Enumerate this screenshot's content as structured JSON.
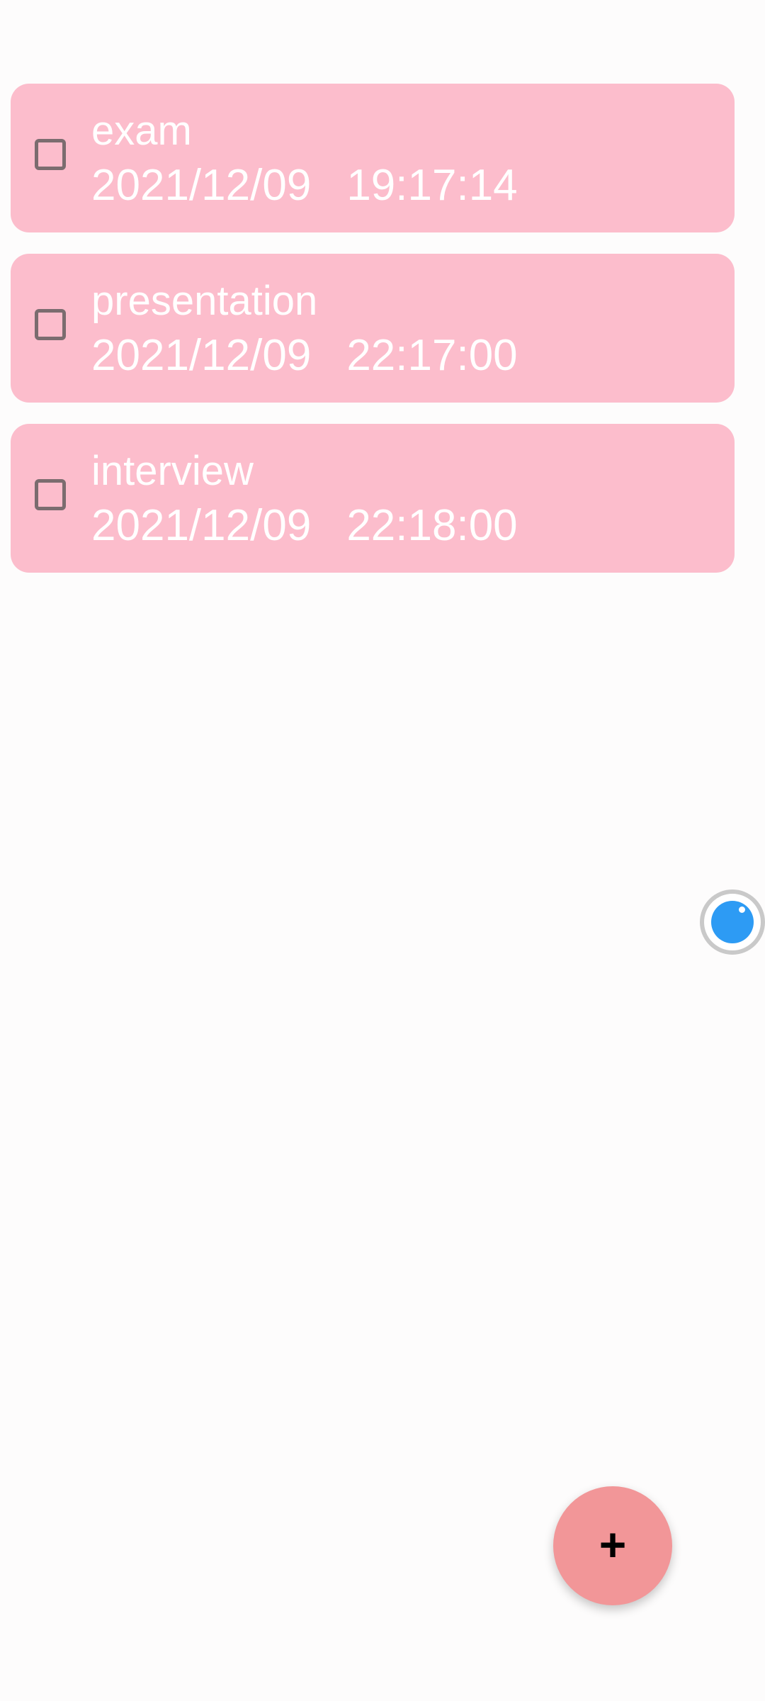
{
  "tasks": [
    {
      "title": "exam",
      "date": "2021/12/09",
      "time": "19:17:14",
      "checked": false
    },
    {
      "title": "presentation",
      "date": "2021/12/09",
      "time": "22:17:00",
      "checked": false
    },
    {
      "title": "interview",
      "date": "2021/12/09",
      "time": "22:18:00",
      "checked": false
    }
  ],
  "fab": {
    "label": "+",
    "icon": "plus-icon"
  },
  "floating_ball": {
    "icon": "assistive-ball-icon"
  },
  "colors": {
    "card": "#fcbdcc",
    "fab": "#f29698",
    "ball": "#2d9bf4",
    "background": "#fdfcfc"
  }
}
